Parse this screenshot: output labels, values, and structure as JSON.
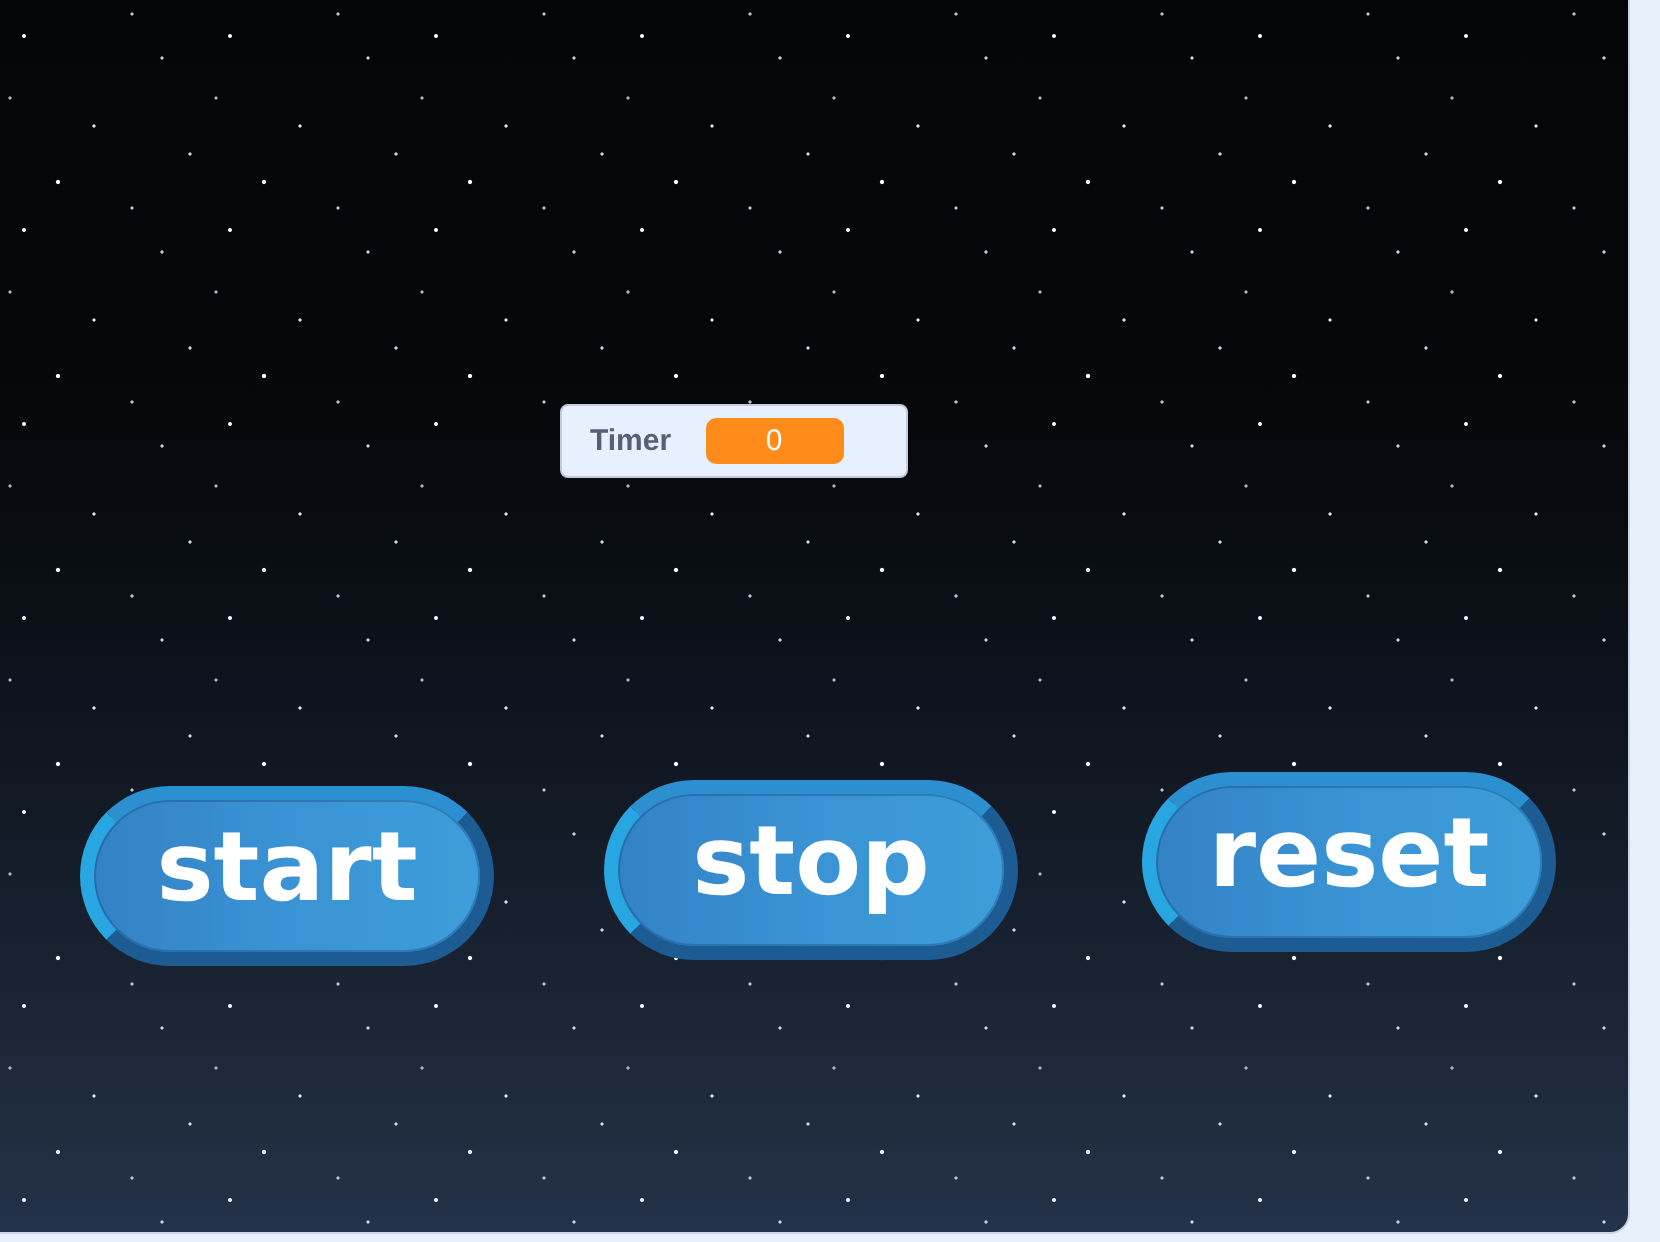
{
  "stage": {
    "monitors": [
      {
        "label": "Timer",
        "value": "0"
      }
    ],
    "sprites": [
      {
        "label": "start"
      },
      {
        "label": "stop"
      },
      {
        "label": "reset"
      }
    ]
  }
}
